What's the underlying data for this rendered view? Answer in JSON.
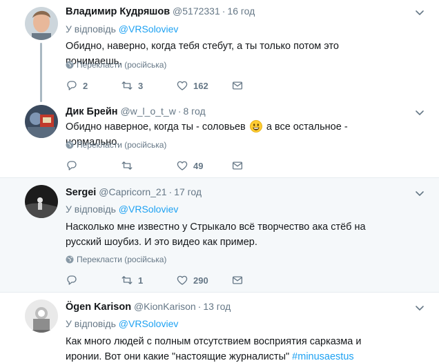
{
  "translate_label": "Перекласти (російська)",
  "reply_prefix": "У відповідь",
  "tweets": [
    {
      "name": "Владимир Кудряшов",
      "handle": "@5172331",
      "time": "16 год",
      "reply_to": "@VRSoloviev",
      "text": "Обидно, наверно, когда тебя стебут, а ты только потом это понимаешь.",
      "replies": "2",
      "retweets": "3",
      "likes": "162"
    },
    {
      "name": "Дик Брейн",
      "handle": "@w_l_o_t_w",
      "time": "8 год",
      "text_before": "Обидно наверное, когда ты - соловьев",
      "text_after": "а все остальное - нормально.",
      "replies": "",
      "retweets": "",
      "likes": "49"
    },
    {
      "name": "Sergei",
      "handle": "@Capricorn_21",
      "time": "17 год",
      "reply_to": "@VRSoloviev",
      "text": "Насколько мне известно у Стрыкало всё творчество ака стёб на русский шоубиз. И это видео как пример.",
      "replies": "",
      "retweets": "1",
      "likes": "290"
    },
    {
      "name": "Ögen Karison",
      "handle": "@KionKarison",
      "time": "13 год",
      "reply_to": "@VRSoloviev",
      "text_before": "Как много людей с полным отсутствием восприятия сарказма и иронии. Вот они какие \"настоящие журналисты\"",
      "hashtag": "#minusaestus"
    }
  ]
}
